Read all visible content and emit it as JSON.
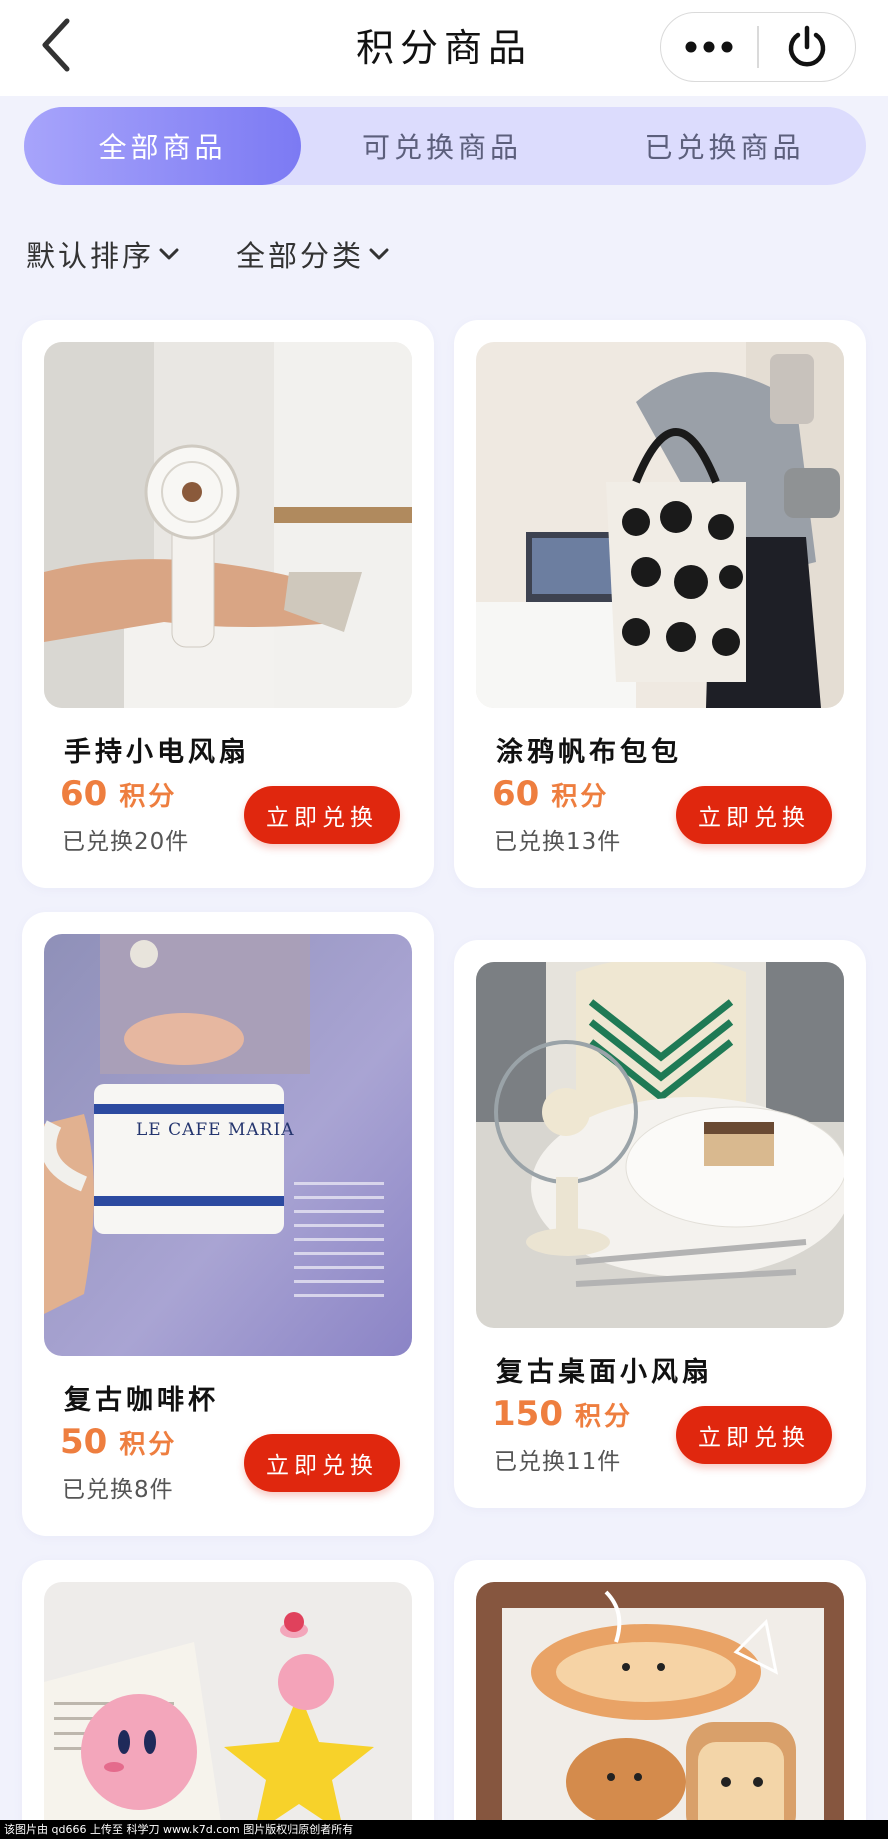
{
  "header": {
    "title": "积分商品",
    "back_icon": "chevron-left-icon",
    "more_icon": "more-dots-icon",
    "power_icon": "power-icon"
  },
  "tabs": [
    {
      "label": "全部商品",
      "active": true
    },
    {
      "label": "可兑换商品",
      "active": false
    },
    {
      "label": "已兑换商品",
      "active": false
    }
  ],
  "filters": [
    {
      "label": "默认排序"
    },
    {
      "label": "全部分类"
    }
  ],
  "products": [
    {
      "name": "手持小电风扇",
      "points": "60",
      "points_unit": "积分",
      "sold": "已兑换20件",
      "button": "立即兑换",
      "image": "handheld-fan-photo"
    },
    {
      "name": "涂鸦帆布包包",
      "points": "60",
      "points_unit": "积分",
      "sold": "已兑换13件",
      "button": "立即兑换",
      "image": "canvas-tote-bag-photo"
    },
    {
      "name": "复古咖啡杯",
      "points": "50",
      "points_unit": "积分",
      "sold": "已兑换8件",
      "button": "立即兑换",
      "image": "coffee-cup-photo"
    },
    {
      "name": "复古桌面小风扇",
      "points": "150",
      "points_unit": "积分",
      "sold": "已兑换11件",
      "button": "立即兑换",
      "image": "desk-fan-photo"
    },
    {
      "name": "",
      "image": "kirby-toys-photo"
    },
    {
      "name": "",
      "image": "bread-plush-photo"
    }
  ],
  "colors": {
    "page_bg": "#f1f2fc",
    "tab_active": "#7c7af3",
    "tab_bar": "#dcdcfd",
    "points": "#ee7e3f",
    "button": "#e0270e"
  },
  "watermark": "该图片由 qd666 上传至 科学刀 www.k7d.com 图片版权归原创者所有",
  "image_texts": {
    "cup_text": "LE CAFE MARIA"
  }
}
